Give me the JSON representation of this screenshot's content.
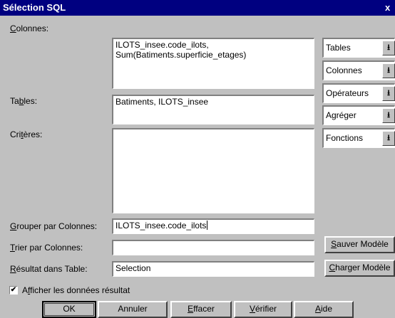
{
  "title": "Sélection SQL",
  "close_glyph": "x",
  "labels": {
    "colonnes": {
      "ul": "C",
      "rest": "olonnes:"
    },
    "tables": {
      "pre": "Ta",
      "ul": "b",
      "rest": "les:"
    },
    "criteres": {
      "pre": "Cri",
      "ul": "t",
      "rest": "ères:"
    },
    "grouper": {
      "ul": "G",
      "rest": "rouper par Colonnes:"
    },
    "trier": {
      "ul": "T",
      "rest": "rier par Colonnes:"
    },
    "resultat": {
      "ul": "R",
      "rest": "ésultat dans Table:"
    }
  },
  "fields": {
    "colonnes": "ILOTS_insee.code_ilots,\nSum(Batiments.superficie_etages)",
    "tables": "Batiments, ILOTS_insee",
    "criteres": "",
    "grouper": "ILOTS_insee.code_ilots",
    "trier": "",
    "resultat": "Selection"
  },
  "combos": [
    {
      "label": "Tables",
      "icon": "dropdown-arrow-icon"
    },
    {
      "label": "Colonnes",
      "icon": "dropdown-arrow-icon"
    },
    {
      "label": "Opérateurs",
      "icon": "dropdown-arrow-icon"
    },
    {
      "label": "Agréger",
      "icon": "dropdown-arrow-icon"
    },
    {
      "label": "Fonctions",
      "icon": "dropdown-arrow-icon"
    }
  ],
  "arrow_glyph": "⭳",
  "side_buttons": {
    "sauver": {
      "ul": "S",
      "rest": "auver Modèle"
    },
    "charger": {
      "ul": "C",
      "rest": "harger Modèle"
    }
  },
  "checkbox": {
    "checked": true,
    "mark": "✔",
    "pre": "A",
    "ul": "f",
    "rest": "ficher les données résultat"
  },
  "buttons": {
    "ok": "OK",
    "annuler": "Annuler",
    "effacer": {
      "ul": "E",
      "rest": "ffacer"
    },
    "verifier": {
      "ul": "V",
      "rest": "érifier"
    },
    "aide": {
      "ul": "A",
      "rest": "ide"
    }
  }
}
